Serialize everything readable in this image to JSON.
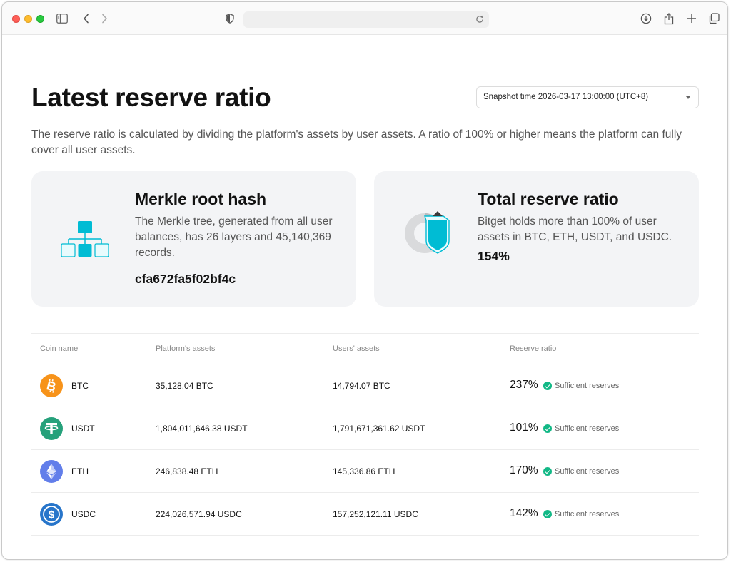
{
  "page": {
    "title": "Latest reserve ratio",
    "snapshot_select": "Snapshot time 2026-03-17 13:00:00 (UTC+8)",
    "intro": "The reserve ratio is calculated by dividing the platform's assets by user assets. A ratio of 100% or higher means the platform can fully cover all user assets."
  },
  "cards": {
    "merkle": {
      "title": "Merkle root hash",
      "description": "The Merkle tree, generated from all user balances, has 26 layers and 45,140,369 records.",
      "hash": "cfa672fa5f02bf4c",
      "icon": "merkle-tree-icon"
    },
    "reserve": {
      "title": "Total reserve ratio",
      "description": "Bitget holds more than 100% of user assets in BTC, ETH, USDT, and USDC.",
      "ratio": "154%",
      "icon": "shield-pie-icon"
    }
  },
  "table": {
    "headers": [
      "Coin name",
      "Platform's assets",
      "Users' assets",
      "Reserve ratio"
    ],
    "rows": [
      {
        "coin": "BTC",
        "platform": "35,128.04 BTC",
        "users": "14,794.07 BTC",
        "ratio": "237%",
        "status": "Sufficient reserves",
        "icon": "btc-icon",
        "color": "#f7931a"
      },
      {
        "coin": "USDT",
        "platform": "1,804,011,646.38 USDT",
        "users": "1,791,671,361.62 USDT",
        "ratio": "101%",
        "status": "Sufficient reserves",
        "icon": "usdt-icon",
        "color": "#26a17b"
      },
      {
        "coin": "ETH",
        "platform": "246,838.48 ETH",
        "users": "145,336.86 ETH",
        "ratio": "170%",
        "status": "Sufficient reserves",
        "icon": "eth-icon",
        "color": "#627eea"
      },
      {
        "coin": "USDC",
        "platform": "224,026,571.94 USDC",
        "users": "157,252,121.11 USDC",
        "ratio": "142%",
        "status": "Sufficient reserves",
        "icon": "usdc-icon",
        "color": "#2775ca"
      }
    ]
  },
  "colors": {
    "accent": "#00bcd4",
    "success": "#12b886",
    "card_bg": "#f3f4f6"
  }
}
